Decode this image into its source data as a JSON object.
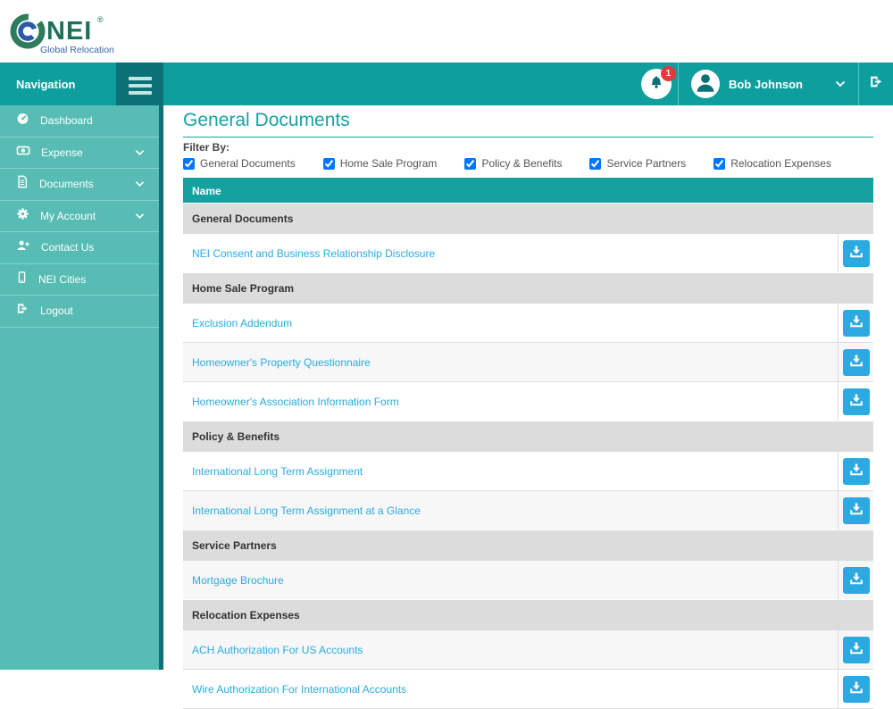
{
  "brand": {
    "name": "NEI",
    "registered": "®",
    "subtitle": "Global Relocation"
  },
  "navbar": {
    "navigation_label": "Navigation",
    "notification_count": "1",
    "user_name": "Bob Johnson"
  },
  "sidebar": {
    "items": [
      {
        "label": "Dashboard",
        "icon": "dashboard-icon",
        "expandable": false
      },
      {
        "label": "Expense",
        "icon": "expense-icon",
        "expandable": true
      },
      {
        "label": "Documents",
        "icon": "documents-icon",
        "expandable": true
      },
      {
        "label": "My Account",
        "icon": "gear-icon",
        "expandable": true
      },
      {
        "label": "Contact Us",
        "icon": "user-plus-icon",
        "expandable": false
      },
      {
        "label": "NEI Cities",
        "icon": "mobile-icon",
        "expandable": false
      },
      {
        "label": "Logout",
        "icon": "sign-out-icon",
        "expandable": false
      }
    ]
  },
  "main": {
    "title": "General Documents",
    "filter_label": "Filter By:",
    "filters": [
      {
        "label": "General Documents",
        "checked": true
      },
      {
        "label": "Home Sale Program",
        "checked": true
      },
      {
        "label": "Policy & Benefits",
        "checked": true
      },
      {
        "label": "Service Partners",
        "checked": true
      },
      {
        "label": "Relocation Expenses",
        "checked": true
      }
    ],
    "table": {
      "header": "Name",
      "rows": [
        {
          "type": "group",
          "label": "General Documents"
        },
        {
          "type": "doc",
          "label": "NEI Consent and Business Relationship Disclosure"
        },
        {
          "type": "group",
          "label": "Home Sale Program"
        },
        {
          "type": "doc",
          "label": "Exclusion Addendum"
        },
        {
          "type": "doc",
          "label": "Homeowner's Property Questionnaire"
        },
        {
          "type": "doc",
          "label": "Homeowner's Association Information Form"
        },
        {
          "type": "group",
          "label": "Policy & Benefits"
        },
        {
          "type": "doc",
          "label": "International Long Term Assignment"
        },
        {
          "type": "doc",
          "label": "International Long Term Assignment at a Glance"
        },
        {
          "type": "group",
          "label": "Service Partners"
        },
        {
          "type": "doc",
          "label": "Mortgage Brochure"
        },
        {
          "type": "group",
          "label": "Relocation Expenses"
        },
        {
          "type": "doc",
          "label": "ACH Authorization For US Accounts"
        },
        {
          "type": "doc",
          "label": "Wire Authorization For International Accounts"
        }
      ]
    }
  },
  "colors": {
    "navbar_teal": "#0F9E9E",
    "dark_teal": "#0B7177",
    "sidebar_teal": "#57BCB4",
    "table_header_teal": "#14A2A0",
    "title_teal": "#18A2A2",
    "link_blue": "#29ABE2",
    "download_button_blue": "#2CA9E1",
    "badge_red": "#E23B3B",
    "group_row_gray": "#DCDCDC",
    "logo_green": "#1E6F5C",
    "logo_blue": "#3A63AD"
  }
}
